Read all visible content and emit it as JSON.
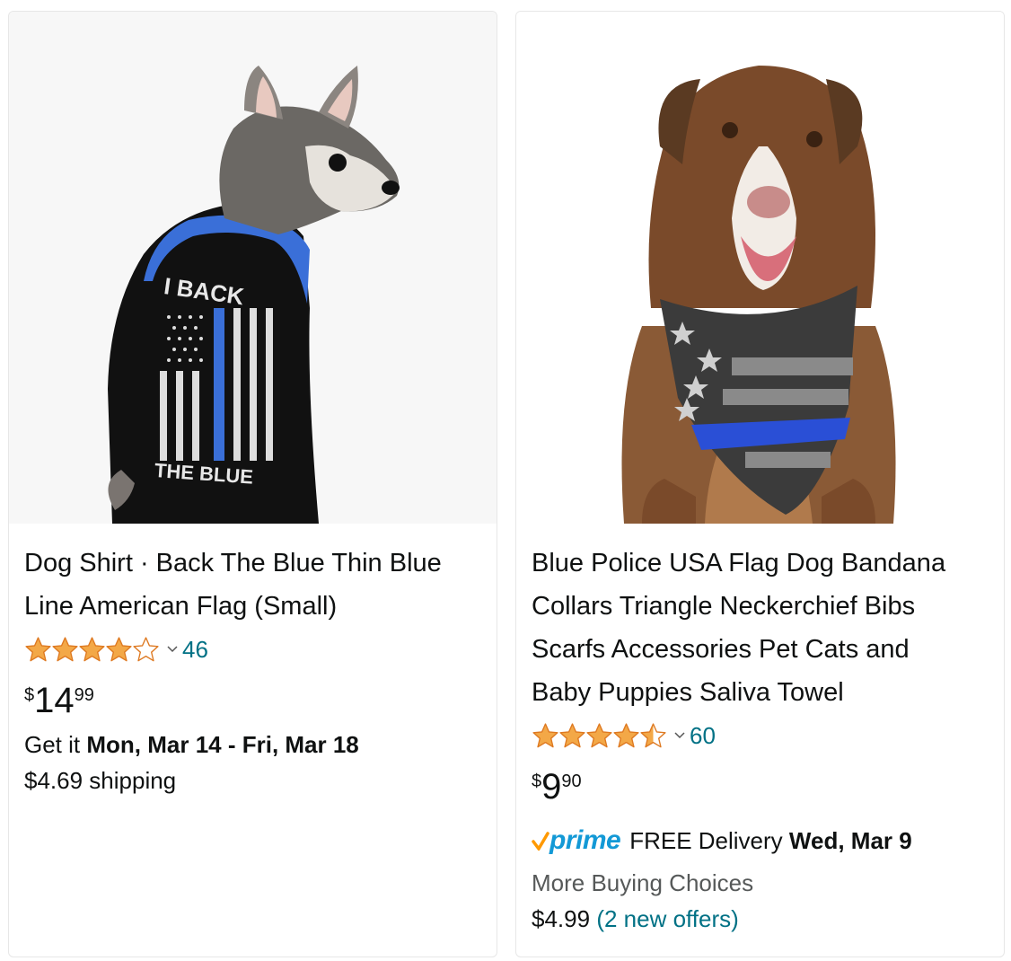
{
  "products": [
    {
      "image_alt": "",
      "shirt_text_top": "I BACK",
      "shirt_text_bottom": "THE BLUE",
      "title_line1": "Dog Shirt · Back The Blue Thin Blue",
      "title_line2": "Line American Flag (Small)",
      "rating": 4.0,
      "rating_count": "46",
      "price_symbol": "$",
      "price_whole": "14",
      "price_fraction": "99",
      "delivery_prefix": "Get it ",
      "delivery_dates": "Mon, Mar 14 - Fri, Mar 18",
      "shipping": "$4.69 shipping"
    },
    {
      "title_line1": "Blue Police USA Flag Dog Bandana",
      "title_line2": "Collars Triangle Neckerchief Bibs",
      "title_line3": "Scarfs Accessories Pet Cats and",
      "title_line4": "Baby Puppies Saliva Towel",
      "rating": 4.5,
      "rating_count": "60",
      "price_symbol": "$",
      "price_whole": "9",
      "price_fraction": "90",
      "prime_label": "prime",
      "delivery_prefix": "FREE Delivery ",
      "delivery_date": "Wed, Mar 9",
      "more_choices_label": "More Buying Choices",
      "offer_price": "$4.99",
      "offer_link": "(2 new offers)"
    }
  ],
  "colors": {
    "star": "#f3a847",
    "link": "#007185",
    "prime": "#1399d6",
    "prime_check": "#ff9900",
    "muted": "#565959"
  }
}
